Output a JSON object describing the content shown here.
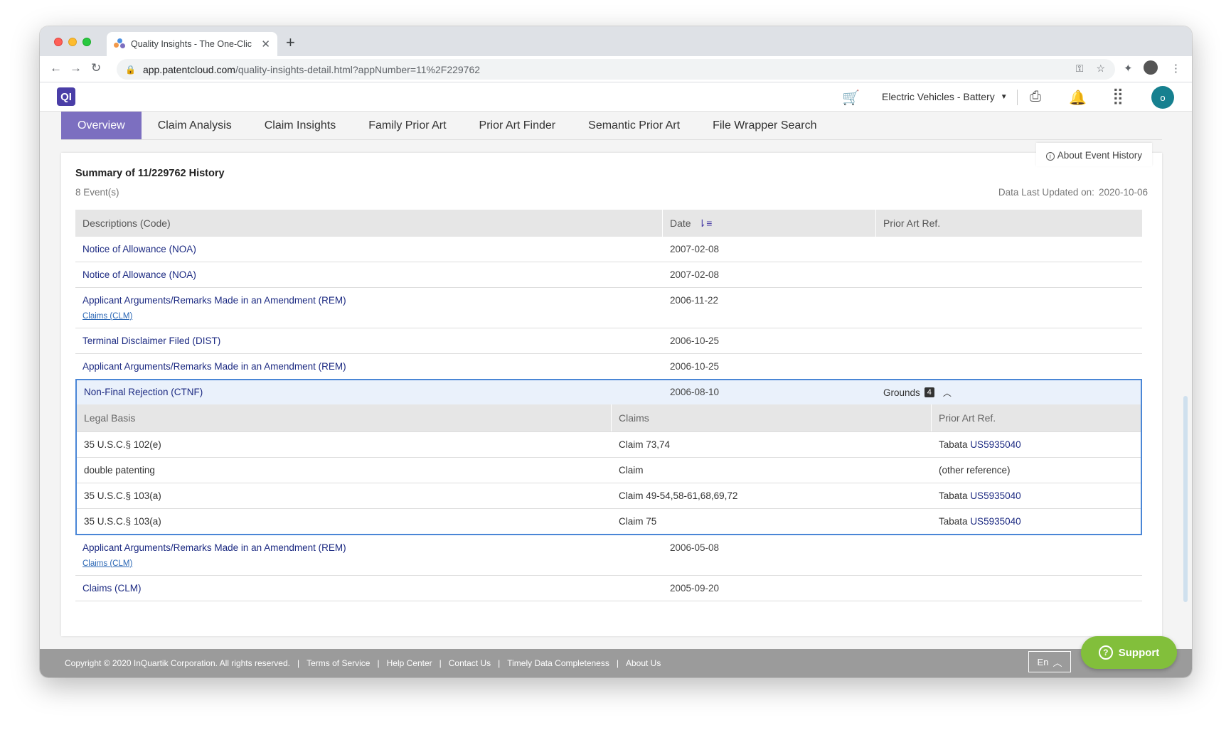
{
  "browser": {
    "tab_title": "Quality Insights - The One-Clic",
    "url_host": "app.patentcloud.com",
    "url_path": "/quality-insights-detail.html?appNumber=11%2F229762"
  },
  "header": {
    "logo": "QI",
    "project": "Electric Vehicles - Battery",
    "avatar": "o"
  },
  "nav_tabs": [
    "Overview",
    "Claim Analysis",
    "Claim Insights",
    "Family Prior Art",
    "Prior Art Finder",
    "Semantic Prior Art",
    "File Wrapper Search"
  ],
  "summary": {
    "about": "About Event History",
    "title": "Summary of 11/229762 History",
    "count": "8 Event(s)",
    "updated_label": "Data Last Updated on:",
    "updated_value": "2020-10-06"
  },
  "events_table": {
    "headers": [
      "Descriptions (Code)",
      "Date",
      "Prior Art Ref."
    ],
    "rows": [
      {
        "desc": "Notice of Allowance (NOA)",
        "sub": "",
        "date": "2007-02-08"
      },
      {
        "desc": "Notice of Allowance (NOA)",
        "sub": "",
        "date": "2007-02-08"
      },
      {
        "desc": "Applicant Arguments/Remarks Made in an Amendment (REM)",
        "sub": "Claims (CLM)",
        "date": "2006-11-22"
      },
      {
        "desc": "Terminal Disclaimer Filed (DIST)",
        "sub": "",
        "date": "2006-10-25"
      },
      {
        "desc": "Applicant Arguments/Remarks Made in an Amendment (REM)",
        "sub": "",
        "date": "2006-10-25"
      }
    ],
    "expanded": {
      "desc": "Non-Final Rejection (CTNF)",
      "date": "2006-08-10",
      "grounds_label": "Grounds",
      "grounds_count": "4",
      "sub_headers": [
        "Legal Basis",
        "Claims",
        "Prior Art Ref."
      ],
      "sub_rows": [
        {
          "basis": "35 U.S.C.§ 102(e)",
          "claims": "Claim 73,74",
          "ref_name": "Tabata",
          "ref_link": "US5935040"
        },
        {
          "basis": "double patenting",
          "claims": "Claim",
          "ref_name": "(other reference)",
          "ref_link": ""
        },
        {
          "basis": "35 U.S.C.§ 103(a)",
          "claims": "Claim 49-54,58-61,68,69,72",
          "ref_name": "Tabata",
          "ref_link": "US5935040"
        },
        {
          "basis": "35 U.S.C.§ 103(a)",
          "claims": "Claim 75",
          "ref_name": "Tabata",
          "ref_link": "US5935040"
        }
      ]
    },
    "rows_after": [
      {
        "desc": "Applicant Arguments/Remarks Made in an Amendment (REM)",
        "sub": "Claims (CLM)",
        "date": "2006-05-08"
      },
      {
        "desc": "Claims (CLM)",
        "sub": "",
        "date": "2005-09-20"
      }
    ]
  },
  "footer": {
    "copyright": "Copyright © 2020 InQuartik Corporation. All rights reserved.",
    "links": [
      "Terms of Service",
      "Help Center",
      "Contact Us",
      "Timely Data Completeness",
      "About Us"
    ],
    "lang": "En"
  },
  "support": "Support"
}
